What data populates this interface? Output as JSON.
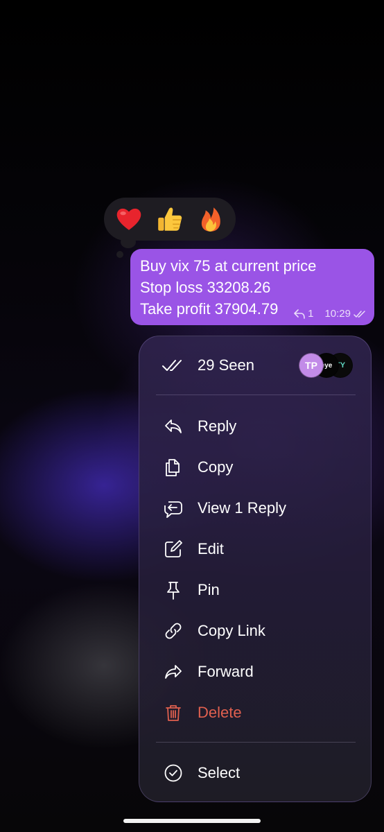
{
  "reactions": [
    {
      "emoji": "❤️",
      "icon": "heart-icon"
    },
    {
      "emoji": "👍",
      "icon": "thumbs-up-icon"
    },
    {
      "emoji": "🔥",
      "icon": "fire-icon"
    }
  ],
  "message": {
    "lines": [
      "Buy vix 75 at current price",
      "Stop loss 33208.26",
      "Take profit 37904.79"
    ],
    "reply_count": "1",
    "time": "10:29",
    "bubble_color": "#9a54e6"
  },
  "menu": {
    "seen": {
      "label": "29 Seen",
      "avatars": [
        "TP",
        "eye",
        "TY"
      ]
    },
    "items": [
      {
        "label": "Reply",
        "icon": "reply-icon"
      },
      {
        "label": "Copy",
        "icon": "copy-icon"
      },
      {
        "label": "View 1 Reply",
        "icon": "view-replies-icon"
      },
      {
        "label": "Edit",
        "icon": "edit-icon"
      },
      {
        "label": "Pin",
        "icon": "pin-icon"
      },
      {
        "label": "Copy Link",
        "icon": "link-icon"
      },
      {
        "label": "Forward",
        "icon": "forward-icon"
      },
      {
        "label": "Delete",
        "icon": "trash-icon",
        "color": "#e0604f"
      }
    ],
    "footer": {
      "label": "Select",
      "icon": "select-check-icon"
    }
  }
}
